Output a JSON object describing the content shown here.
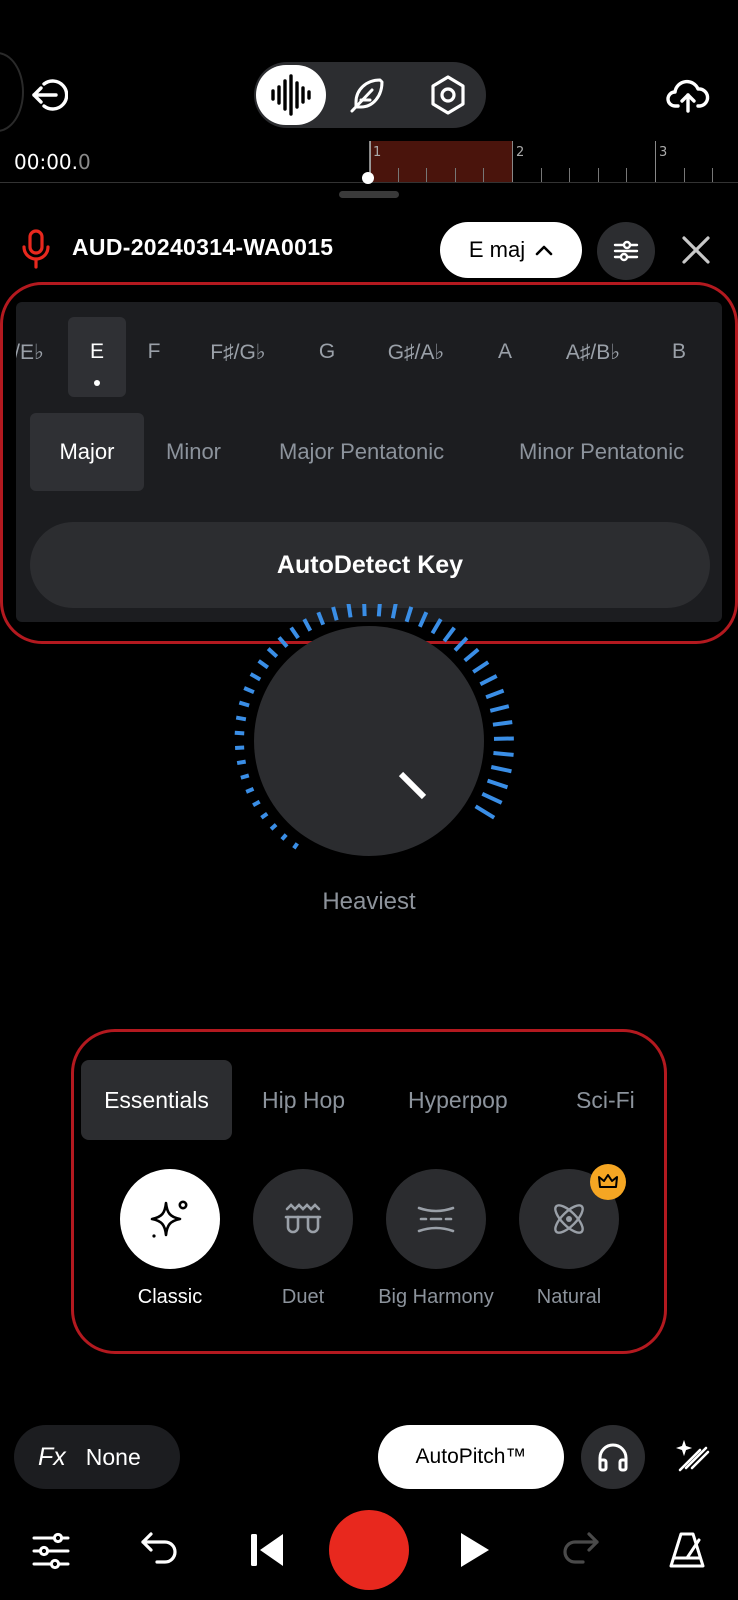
{
  "timeline": {
    "time_main": "00:00.",
    "time_frac": "0",
    "bars": [
      "1",
      "2",
      "3"
    ]
  },
  "track": {
    "name": "AUD-20240314-WA0015",
    "key_label": "E maj"
  },
  "key_panel": {
    "notes": [
      "/E♭",
      "E",
      "F",
      "F♯/G♭",
      "G",
      "G♯/A♭",
      "A",
      "A♯/B♭",
      "B"
    ],
    "selected_note": "E",
    "scales": [
      "Major",
      "Minor",
      "Major Pentatonic",
      "Minor Pentatonic"
    ],
    "selected_scale": "Major",
    "autodetect_label": "AutoDetect Key"
  },
  "knob": {
    "label": "Heaviest"
  },
  "presets": {
    "categories": [
      "Essentials",
      "Hip Hop",
      "Hyperpop",
      "Sci-Fi"
    ],
    "selected_category": "Essentials",
    "items": [
      {
        "label": "Classic",
        "icon": "sparkle-icon",
        "selected": true
      },
      {
        "label": "Duet",
        "icon": "duet-icon"
      },
      {
        "label": "Big Harmony",
        "icon": "harmony-icon"
      },
      {
        "label": "Natural",
        "icon": "atom-icon",
        "premium": true
      }
    ]
  },
  "controls": {
    "fx_glyph": "Fx",
    "fx_value": "None",
    "autopitch_label": "AutoPitch™"
  },
  "colors": {
    "accent_red": "#e8281e",
    "highlight_outline": "#b3191f",
    "knob_blue": "#3a8ee6",
    "premium_gold": "#f5a623",
    "region_fill": "#4a140c"
  }
}
